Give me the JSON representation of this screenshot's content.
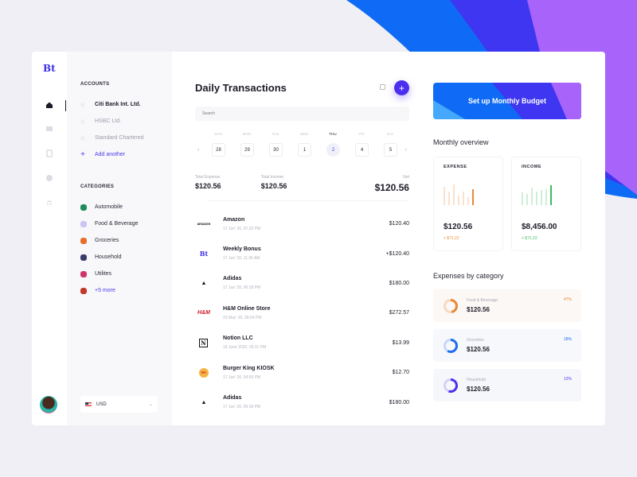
{
  "app": {
    "logo": "Bt"
  },
  "rail": {
    "icons": [
      "home-icon",
      "wallet-icon",
      "document-icon",
      "chart-pie-icon",
      "bank-icon"
    ],
    "active": 0
  },
  "sidebar": {
    "accounts_heading": "ACCOUNTS",
    "accounts": [
      {
        "label": "Citi Bank Int. Ltd.",
        "active": true
      },
      {
        "label": "HSBC Ltd.",
        "active": false
      },
      {
        "label": "Standard Chartered",
        "active": false
      }
    ],
    "add_account_label": "Add another",
    "categories_heading": "CATEGORIES",
    "categories": [
      {
        "label": "Automobile",
        "color": "#1f8a5b"
      },
      {
        "label": "Food & Beverage",
        "color": "#c9c5f4"
      },
      {
        "label": "Groceries",
        "color": "#e5702a"
      },
      {
        "label": "Household",
        "color": "#3b3b6a"
      },
      {
        "label": "Utilites",
        "color": "#d0356a"
      }
    ],
    "more_label": "+5 more",
    "more_color": "#c0392b",
    "currency": "USD"
  },
  "main": {
    "title": "Daily Transactions",
    "search_placeholder": "Search",
    "week": {
      "days": [
        {
          "name": "SUN",
          "num": "28",
          "selected": false
        },
        {
          "name": "MON",
          "num": "29",
          "selected": false
        },
        {
          "name": "TUE",
          "num": "30",
          "selected": false
        },
        {
          "name": "WED",
          "num": "1",
          "selected": false
        },
        {
          "name": "THU",
          "num": "2",
          "selected": true
        },
        {
          "name": "FRI",
          "num": "4",
          "selected": false
        },
        {
          "name": "SAT",
          "num": "5",
          "selected": false
        }
      ]
    },
    "totals": {
      "expense_label": "Total Expense",
      "expense": "$120.56",
      "income_label": "Total Income",
      "income": "$120.56",
      "net_label": "Net",
      "net": "$120.56"
    },
    "transactions": [
      {
        "logo": "amazon",
        "name": "Amazon",
        "date": "17 Jun' 20, 07:32 PM",
        "amount": "$120.40"
      },
      {
        "logo": "Bt",
        "name": "Weekly Bonus",
        "date": "17 Jun' 20, 11:36 AM",
        "amount": "+$120.40"
      },
      {
        "logo": "adidas",
        "name": "Adidas",
        "date": "17 Jun' 20, 06:18 PM",
        "amount": "$180.00"
      },
      {
        "logo": "H&M",
        "name": "H&M Online Store",
        "date": "23 May' 20, 06:04 PM",
        "amount": "$272.57"
      },
      {
        "logo": "N",
        "name": "Notion LLC",
        "date": "18 June 2020, 05:11 PM",
        "amount": "$13.99"
      },
      {
        "logo": "BK",
        "name": "Burger King KIOSK",
        "date": "17 Jun' 20, 04:59 PM",
        "amount": "$12.70"
      },
      {
        "logo": "adidas",
        "name": "Adidas",
        "date": "17 Jun' 20, 06:18 PM",
        "amount": "$180.00"
      }
    ]
  },
  "right": {
    "budget_label": "Set up Monthly Budget",
    "overview_heading": "Monthly overview",
    "expense": {
      "label": "EXPENSE",
      "value": "$120.56",
      "delta": "+ $71.22",
      "color": "#e8893a",
      "bars": [
        0.8,
        0.6,
        0.9,
        0.4,
        0.6,
        0.35,
        0.7
      ]
    },
    "income": {
      "label": "INCOME",
      "value": "$8,456.00",
      "delta": "+ $71.22",
      "color": "#3dbb5e",
      "bars": [
        0.55,
        0.5,
        0.75,
        0.6,
        0.65,
        0.7,
        0.85
      ]
    },
    "categories_heading": "Expenses by category",
    "categories": [
      {
        "label": "Food & Beverage",
        "value": "$120.56",
        "percent": "47%",
        "fraction": 0.47,
        "color": "#e8893a",
        "track": "#f7d9c0",
        "bg": "#fcf8f5"
      },
      {
        "label": "Groceries",
        "value": "$120.56",
        "percent": "18%",
        "fraction": 0.58,
        "color": "#1f6bf0",
        "track": "#c6d8fb",
        "bg": "#f6f8fb"
      },
      {
        "label": "Household",
        "value": "$120.56",
        "percent": "12%",
        "fraction": 0.55,
        "color": "#4b2ff0",
        "track": "#d6d0fb",
        "bg": "#f6f7fb"
      }
    ]
  }
}
